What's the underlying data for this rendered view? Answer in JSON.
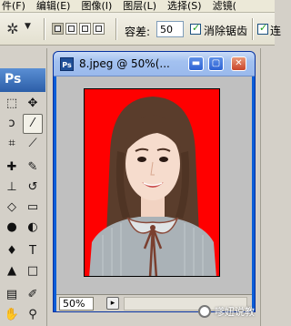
{
  "menubar": {
    "items": [
      "件(F)",
      "编辑(E)",
      "图像(I)",
      "图层(L)",
      "选择(S)",
      "滤镜("
    ]
  },
  "options": {
    "tolerance_label": "容差:",
    "tolerance_value": "50",
    "antialias_label": "消除锯齿",
    "contiguous_label": "连"
  },
  "palette": {
    "logo": "Ps",
    "tools": [
      "marquee-icon",
      "move-icon",
      "lasso-icon",
      "magic-wand-icon",
      "crop-icon",
      "slice-icon",
      "healing-brush-icon",
      "brush-icon",
      "clone-stamp-icon",
      "history-brush-icon",
      "eraser-icon",
      "gradient-icon",
      "blur-icon",
      "dodge-icon",
      "pen-icon",
      "type-icon",
      "path-select-icon",
      "shape-icon",
      "notes-icon",
      "eyedropper-icon",
      "hand-icon",
      "zoom-icon"
    ]
  },
  "document": {
    "title": "8.jpeg @ 50%(...",
    "zoom": "50%",
    "background_color": "#ff0000"
  },
  "watermark": {
    "text": "嗲妞说教"
  }
}
